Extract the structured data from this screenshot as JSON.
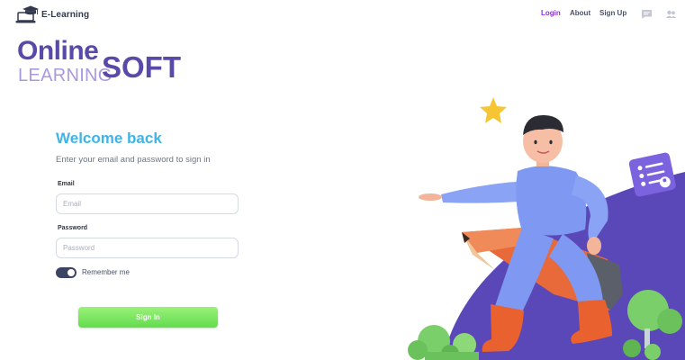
{
  "header": {
    "logo_text": "E-Learning",
    "logo_icon": "graduation-laptop-icon",
    "nav": [
      {
        "label": "Login",
        "active": true
      },
      {
        "label": "About",
        "active": false
      },
      {
        "label": "Sign Up",
        "active": false
      }
    ],
    "icons": [
      "chat-icon",
      "users-icon"
    ]
  },
  "brand": {
    "line1": "Online",
    "line2": "LEARNING",
    "line3": "SOFT"
  },
  "form": {
    "title": "Welcome back",
    "subtitle": "Enter your email and password to sign in",
    "email_label": "Email",
    "email_placeholder": "Email",
    "email_value": "",
    "password_label": "Password",
    "password_placeholder": "Password",
    "password_value": "",
    "remember_label": "Remember me",
    "remember_checked": true,
    "submit_label": "Sign In"
  },
  "colors": {
    "brand_primary": "#5a4aa7",
    "brand_light": "#a999de",
    "title_blue": "#3fb4e8",
    "active_nav": "#8b2ed4",
    "button_green": "#63dc4e",
    "toggle_dark": "#3b4463"
  }
}
